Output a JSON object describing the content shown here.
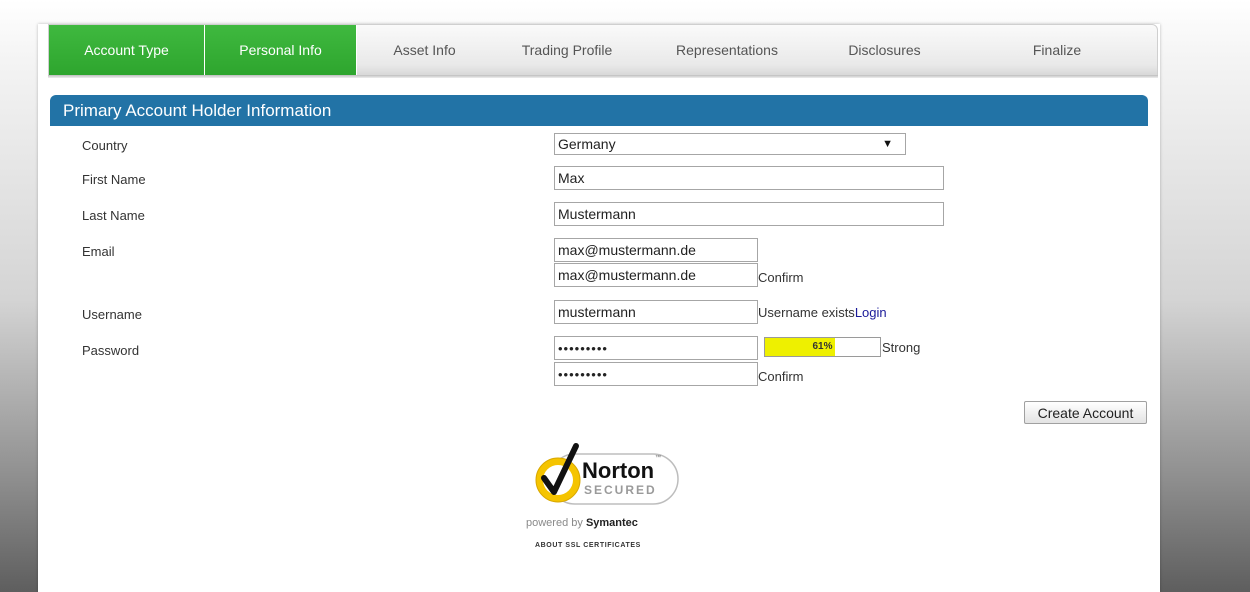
{
  "tabs": [
    {
      "label": "Account Type",
      "active": true
    },
    {
      "label": "Personal Info",
      "active": true
    },
    {
      "label": "Asset Info",
      "active": false
    },
    {
      "label": "Trading Profile",
      "active": false
    },
    {
      "label": "Representations",
      "active": false
    },
    {
      "label": "Disclosures",
      "active": false
    },
    {
      "label": "Finalize",
      "active": false
    }
  ],
  "section": {
    "title": "Primary Account Holder Information"
  },
  "form": {
    "country": {
      "label": "Country",
      "value": "Germany"
    },
    "first_name": {
      "label": "First Name",
      "value": "Max"
    },
    "last_name": {
      "label": "Last Name",
      "value": "Mustermann"
    },
    "email": {
      "label": "Email",
      "value": "max@mustermann.de",
      "confirm_value": "max@mustermann.de",
      "confirm_label": "Confirm"
    },
    "username": {
      "label": "Username",
      "value": "mustermann",
      "status": "Username exists",
      "login_link": "Login"
    },
    "password": {
      "label": "Password",
      "value": "abcdefghi",
      "confirm_value": "abcdefghi",
      "confirm_label": "Confirm",
      "strength_text": "61%",
      "strength_fraction": 0.61,
      "strength_label": "Strong",
      "strength_color": "#eef000"
    }
  },
  "actions": {
    "create_account": "Create Account"
  },
  "seal": {
    "brand": "Norton",
    "tagline": "SECURED",
    "trademark": "™",
    "powered_prefix": "powered by ",
    "powered_brand": "Symantec",
    "about_link": "ABOUT SSL CERTIFICATES"
  },
  "colors": {
    "tab_active": "#2ea52e",
    "section_header": "#2273a6",
    "link": "#1a1a99"
  }
}
